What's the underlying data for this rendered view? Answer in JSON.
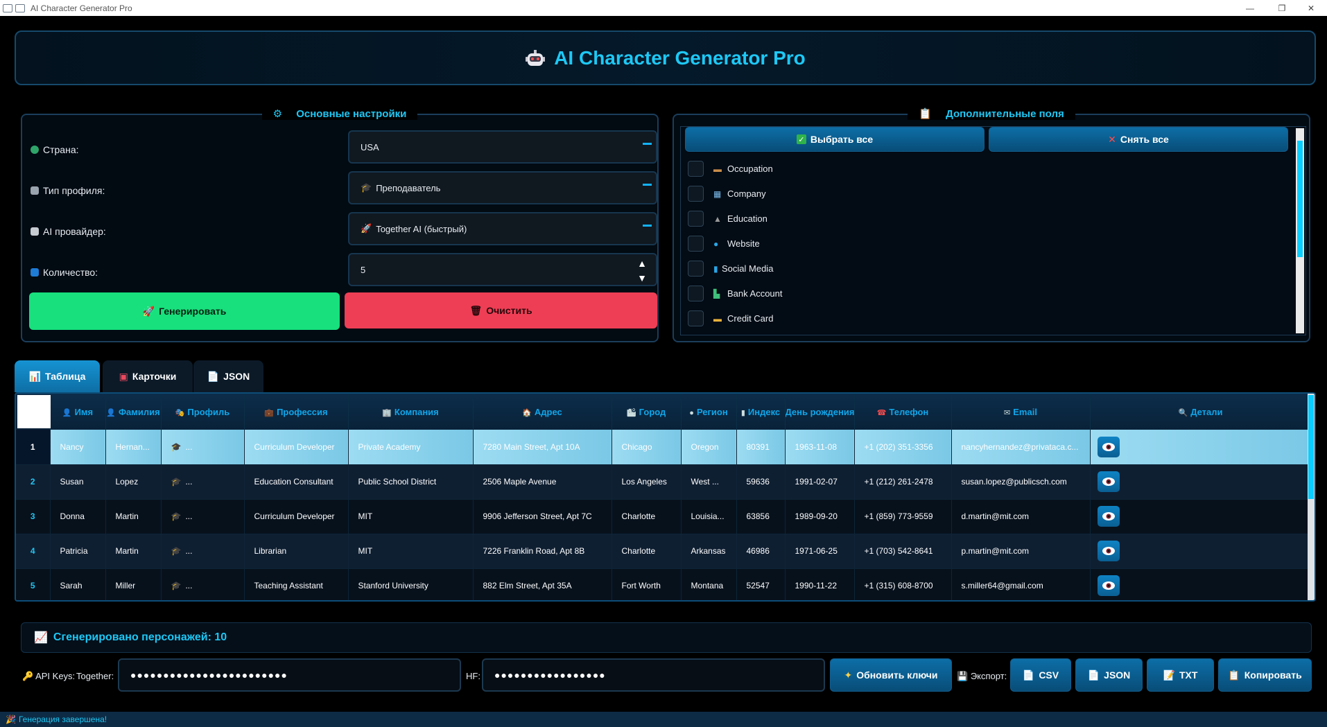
{
  "window": {
    "title": "AI Character Generator Pro",
    "minimize_glyph": "—",
    "restore_glyph": "❐",
    "close_glyph": "✕"
  },
  "header": {
    "title": "AI Character Generator Pro"
  },
  "main_settings": {
    "title": "Основные настройки",
    "country_label": "Страна:",
    "country_value": "USA",
    "profile_label": "Тип профиля:",
    "profile_value": "Преподаватель",
    "provider_label": "AI провайдер:",
    "provider_value": "Together AI (быстрый)",
    "count_label": "Количество:",
    "count_value": "5",
    "generate_label": "Генерировать",
    "clear_label": "Очистить"
  },
  "extra_fields": {
    "title": "Дополнительные поля",
    "select_all": "Выбрать все",
    "deselect_all": "Снять все",
    "items": [
      {
        "label": "Occupation",
        "icon": "briefcase-icon",
        "checked": false
      },
      {
        "label": "Company",
        "icon": "building-icon",
        "checked": false
      },
      {
        "label": "Education",
        "icon": "graduation-cap-icon",
        "checked": false
      },
      {
        "label": "Website",
        "icon": "globe-icon",
        "checked": false
      },
      {
        "label": "Social Media",
        "icon": "phone-icon",
        "checked": false
      },
      {
        "label": "Bank Account",
        "icon": "bank-icon",
        "checked": false
      },
      {
        "label": "Credit Card",
        "icon": "credit-card-icon",
        "checked": false
      }
    ]
  },
  "tabs": [
    {
      "label": "Таблица",
      "active": true
    },
    {
      "label": "Карточки",
      "active": false
    },
    {
      "label": "JSON",
      "active": false
    }
  ],
  "table": {
    "columns": [
      "Имя",
      "Фамилия",
      "Профиль",
      "Профессия",
      "Компания",
      "Адрес",
      "Город",
      "Регион",
      "Индекс",
      "День рождения",
      "Телефон",
      "Email",
      "Детали"
    ],
    "rows": [
      {
        "num": "1",
        "cells": [
          "Nancy",
          "Hernan...",
          "...",
          "Curriculum Developer",
          "Private Academy",
          "7280 Main Street, Apt 10A",
          "Chicago",
          "Oregon",
          "80391",
          "1963-11-08",
          "+1 (202) 351-3356",
          "nancyhernandez@privataca.c..."
        ]
      },
      {
        "num": "2",
        "cells": [
          "Susan",
          "Lopez",
          "...",
          "Education Consultant",
          "Public School District",
          "2506 Maple Avenue",
          "Los Angeles",
          "West ...",
          "59636",
          "1991-02-07",
          "+1 (212) 261-2478",
          "susan.lopez@publicsch.com"
        ]
      },
      {
        "num": "3",
        "cells": [
          "Donna",
          "Martin",
          "...",
          "Curriculum Developer",
          "MIT",
          "9906 Jefferson Street, Apt 7C",
          "Charlotte",
          "Louisia...",
          "63856",
          "1989-09-20",
          "+1 (859) 773-9559",
          "d.martin@mit.com"
        ]
      },
      {
        "num": "4",
        "cells": [
          "Patricia",
          "Martin",
          "...",
          "Librarian",
          "MIT",
          "7226 Franklin Road, Apt 8B",
          "Charlotte",
          "Arkansas",
          "46986",
          "1971-06-25",
          "+1 (703) 542-8641",
          "p.martin@mit.com"
        ]
      },
      {
        "num": "5",
        "cells": [
          "Sarah",
          "Miller",
          "...",
          "Teaching Assistant",
          "Stanford University",
          "882 Elm Street, Apt 35A",
          "Fort Worth",
          "Montana",
          "52547",
          "1990-11-22",
          "+1 (315) 608-8700",
          "s.miller64@gmail.com"
        ]
      }
    ]
  },
  "summary": {
    "text": "Сгенерировано персонажей: 10"
  },
  "keys": {
    "api_keys_label": "API Keys:",
    "together_label": "Together:",
    "together_value": "●●●●●●●●●●●●●●●●●●●●●●●●",
    "hf_label": "HF:",
    "hf_value": "●●●●●●●●●●●●●●●●●",
    "update_label": "Обновить ключи",
    "export_label": "Экспорт:",
    "csv": "CSV",
    "json": "JSON",
    "txt": "TXT",
    "copy": "Копировать"
  },
  "status": {
    "text": "Генерация завершена!"
  },
  "colors": {
    "accent": "#1ec8f5",
    "generate": "#17e07c",
    "clear": "#ee3e55",
    "button_blue": "#0d6ea7"
  }
}
